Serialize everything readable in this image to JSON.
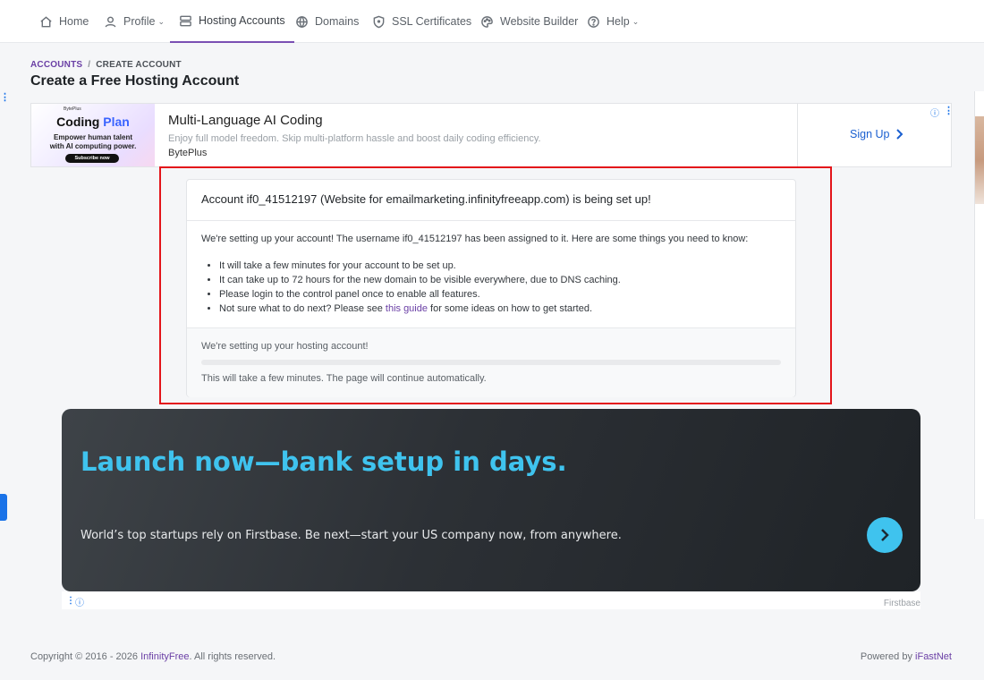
{
  "nav": {
    "items": [
      {
        "label": "Home",
        "icon": "home-icon"
      },
      {
        "label": "Profile",
        "icon": "user-icon",
        "has_caret": true
      },
      {
        "label": "Hosting Accounts",
        "icon": "server-icon",
        "active": true
      },
      {
        "label": "Domains",
        "icon": "globe-icon"
      },
      {
        "label": "SSL Certificates",
        "icon": "shield-icon"
      },
      {
        "label": "Website Builder",
        "icon": "palette-icon"
      },
      {
        "label": "Help",
        "icon": "question-icon",
        "has_caret": true
      }
    ]
  },
  "breadcrumb": {
    "link": "ACCOUNTS",
    "separator": "/",
    "current": "CREATE ACCOUNT"
  },
  "page_title": "Create a Free Hosting Account",
  "ad_top": {
    "image_logo": "BytePlus",
    "image_title_a": "Coding",
    "image_title_b": "Plan",
    "image_subtitle_1": "Empower human talent",
    "image_subtitle_2": "with AI computing power.",
    "image_button": "Subscribe now",
    "headline": "Multi-Language AI Coding",
    "description": "Enjoy full model freedom. Skip multi-platform hassle and boost daily coding efficiency.",
    "brand": "BytePlus",
    "cta": "Sign Up"
  },
  "card": {
    "title": "Account if0_41512197 (Website for emailmarketing.infinityfreeapp.com) is being set up!",
    "intro": "We're setting up your account! The username if0_41512197 has been assigned to it. Here are some things you need to know:",
    "bullets": [
      "It will take a few minutes for your account to be set up.",
      "It can take up to 72 hours for the new domain to be visible everywhere, due to DNS caching.",
      "Please login to the control panel once to enable all features."
    ],
    "last_bullet_prefix": "Not sure what to do next? Please see ",
    "last_bullet_link": "this guide",
    "last_bullet_suffix": " for some ideas on how to get started.",
    "status": "We're setting up your hosting account!",
    "progress": 0,
    "note": "This will take a few minutes. The page will continue automatically."
  },
  "ad_bottom": {
    "headline": "Launch now—bank setup in days.",
    "description": "World’s top startups rely on Firstbase. Be next—start your US company now, from anywhere.",
    "brand": "Firstbase"
  },
  "footer": {
    "copyright_prefix": "Copyright © 2016 - 2026 ",
    "copyright_link": "InfinityFree",
    "copyright_suffix": ". All rights reserved.",
    "powered_prefix": "Powered by ",
    "powered_link": "iFastNet"
  },
  "colors": {
    "accent": "#6a3fa5",
    "highlight": "#e3151a",
    "ad_accent": "#3fc3ee",
    "link_blue": "#1a5fd0"
  }
}
